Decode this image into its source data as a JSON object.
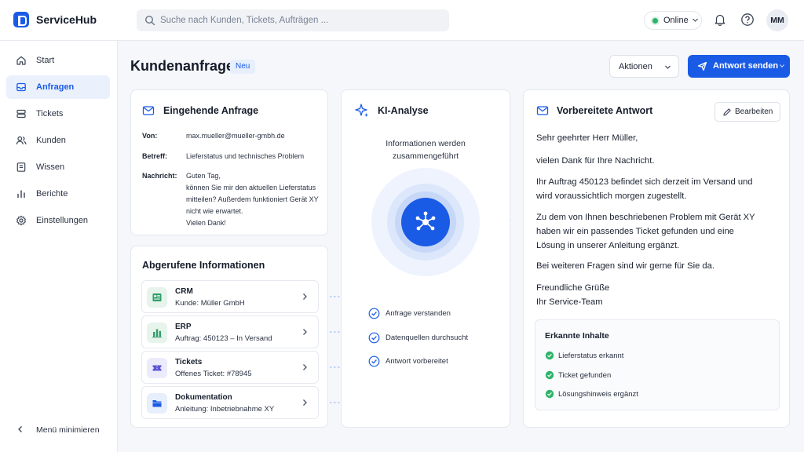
{
  "app": {
    "name": "ServiceHub"
  },
  "search": {
    "placeholder": "Suche nach Kunden, Tickets, Aufträgen ..."
  },
  "header": {
    "status": "Online",
    "avatar_initials": "MM"
  },
  "sidebar": {
    "items": [
      {
        "label": "Start",
        "icon": "home-icon"
      },
      {
        "label": "Anfragen",
        "icon": "inbox-icon",
        "active": true
      },
      {
        "label": "Tickets",
        "icon": "ticket-icon"
      },
      {
        "label": "Kunden",
        "icon": "users-icon"
      },
      {
        "label": "Wissen",
        "icon": "book-icon"
      },
      {
        "label": "Berichte",
        "icon": "chart-icon"
      },
      {
        "label": "Einstellungen",
        "icon": "gear-icon"
      }
    ],
    "collapse_label": "Menü minimieren"
  },
  "page": {
    "title": "Kundenanfrage",
    "badge": "Neu",
    "actions_label": "Aktionen",
    "send_label": "Antwort senden"
  },
  "incoming": {
    "title": "Eingehende Anfrage",
    "from_label": "Von:",
    "from": "max.mueller@mueller-gmbh.de",
    "subject_label": "Betreff:",
    "subject": "Lieferstatus und technisches Problem",
    "message_label": "Nachricht:",
    "message_lines": [
      "Guten Tag,",
      "können Sie mir den aktuellen Lieferstatus",
      "mitteilen? Außerdem funktioniert Gerät XY",
      "nicht wie erwartet.",
      "Vielen Dank!"
    ]
  },
  "fetched": {
    "title": "Abgerufene Informationen",
    "sources": [
      {
        "name": "CRM",
        "detail": "Kunde: Müller GmbH",
        "icon": "crm-icon",
        "color": "#2f9e6a",
        "bg": "#e6f4ec"
      },
      {
        "name": "ERP",
        "detail": "Auftrag: 450123 – In Versand",
        "icon": "bar-chart-icon",
        "color": "#2f9e6a",
        "bg": "#e6f4ec"
      },
      {
        "name": "Tickets",
        "detail": "Offenes Ticket: #78945",
        "icon": "ticket-icon",
        "color": "#5b55d6",
        "bg": "#ecebfb"
      },
      {
        "name": "Dokumentation",
        "detail": "Anleitung: Inbetriebnahme XY",
        "icon": "folder-icon",
        "color": "#1a5be6",
        "bg": "#e7eefc"
      }
    ]
  },
  "ai": {
    "title": "KI-Analyse",
    "subtitle_lines": [
      "Informationen werden",
      "zusammengeführt"
    ],
    "steps": [
      "Anfrage verstanden",
      "Datenquellen durchsucht",
      "Antwort vorbereitet"
    ]
  },
  "prepared": {
    "title": "Vorbereitete Antwort",
    "edit_label": "Bearbeiten",
    "lines": [
      "Sehr geehrter Herr Müller,",
      "vielen Dank für Ihre Nachricht.",
      "Ihr Auftrag 450123 befindet sich derzeit im Versand und",
      "wird voraussichtlich morgen zugestellt.",
      "Zu dem von Ihnen beschriebenen Problem mit Gerät XY",
      "haben wir ein passendes Ticket gefunden und eine",
      "Lösung in unserer Anleitung ergänzt.",
      "Bei weiteren Fragen sind wir gerne für Sie da.",
      "Freundliche Grüße",
      "Ihr Service-Team"
    ],
    "detected_title": "Erkannte Inhalte",
    "detected": [
      "Lieferstatus erkannt",
      "Ticket gefunden",
      "Lösungshinweis ergänzt"
    ]
  },
  "colors": {
    "accent": "#1a5be6",
    "success": "#2fb36a"
  }
}
